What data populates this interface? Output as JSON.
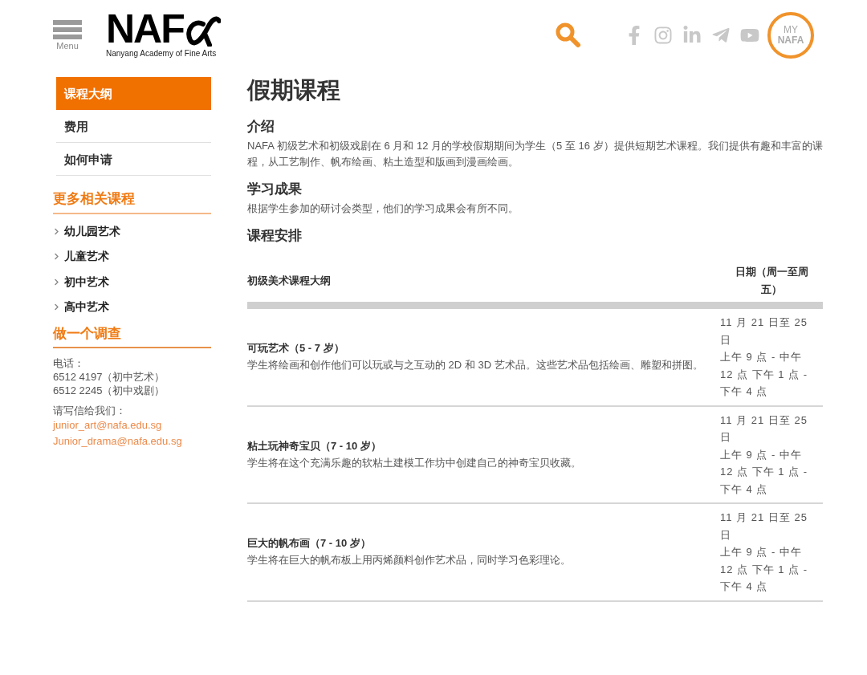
{
  "header": {
    "menu_label": "Menu",
    "logo_text": "NAF",
    "logo_tagline": "Nanyang Academy of Fine Arts",
    "my_nafa": {
      "line_1": "MY",
      "line_2": "NAFA"
    }
  },
  "sidebar": {
    "nav": [
      {
        "label": "课程大纲",
        "selected": true
      },
      {
        "label": "费用",
        "selected": false
      },
      {
        "label": "如何申请",
        "selected": false
      }
    ],
    "related_title": "更多相关课程",
    "related": [
      "幼儿园艺术",
      "儿童艺术",
      "初中艺术",
      "高中艺术"
    ],
    "survey_title": "做一个调查",
    "phone_label": "电话：",
    "phones": [
      "6512 4197（初中艺术）",
      "6512 2245（初中戏剧）"
    ],
    "email_label": "请写信给我们：",
    "emails": [
      "junior_art@nafa.edu.sg",
      "Junior_drama@nafa.edu.sg"
    ]
  },
  "main": {
    "title": "假期课程",
    "sections": [
      {
        "heading": "介绍",
        "body": "NAFA 初级艺术和初级戏剧在 6 月和 12 月的学校假期期间为学生（5 至 16 岁）提供短期艺术课程。我们提供有趣和丰富的课程，从工艺制作、帆布绘画、粘土造型和版画到漫画绘画。"
      },
      {
        "heading": "学习成果",
        "body": "根据学生参加的研讨会类型，他们的学习成果会有所不同。"
      },
      {
        "heading": "课程安排"
      }
    ],
    "table": {
      "columns": [
        "初级美术课程大纲",
        "日期（周一至周五）"
      ],
      "rows": [
        {
          "name": "可玩艺术（5 - 7 岁）",
          "description": "学生将绘画和创作他们可以玩或与之互动的 2D 和 3D 艺术品。这些艺术品包括绘画、雕塑和拼图。",
          "date": "11 月 21 日至 25 日",
          "time": "上午 9 点 - 中午 12 点 下午 1 点 - 下午 4 点"
        },
        {
          "name": "粘土玩神奇宝贝（7 - 10 岁）",
          "description": "学生将在这个充满乐趣的软粘土建模工作坊中创建自己的神奇宝贝收藏。",
          "date": "11 月 21 日至 25 日",
          "time": "上午 9 点 - 中午 12 点 下午 1 点 - 下午 4 点"
        },
        {
          "name": "巨大的帆布画（7 - 10 岁）",
          "description": "学生将在巨大的帆布板上用丙烯颜料创作艺术品，同时学习色彩理论。",
          "date": "11 月 21 日至 25 日",
          "time": "上午 9 点 - 中午 12 点 下午 1 点 - 下午 4 点"
        }
      ]
    }
  }
}
